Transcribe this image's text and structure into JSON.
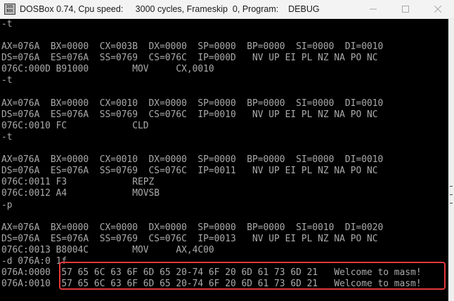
{
  "window": {
    "title": "DOSBox 0.74, Cpu speed:     3000 cycles, Frameskip  0, Program:    DEBUG",
    "icon_label": "DOS BOX"
  },
  "caption": {
    "minimize": "minimize-icon",
    "maximize": "maximize-icon",
    "close": "close-icon"
  },
  "terminal": {
    "lines": [
      "-t",
      "",
      "AX=076A  BX=0000  CX=003B  DX=0000  SP=0000  BP=0000  SI=0000  DI=0010",
      "DS=076A  ES=076A  SS=0769  CS=076C  IP=000D   NV UP EI PL NZ NA PO NC",
      "076C:000D B91000        MOV     CX,0010",
      "-t",
      "",
      "AX=076A  BX=0000  CX=0010  DX=0000  SP=0000  BP=0000  SI=0000  DI=0010",
      "DS=076A  ES=076A  SS=0769  CS=076C  IP=0010   NV UP EI PL NZ NA PO NC",
      "076C:0010 FC            CLD",
      "-t",
      "",
      "AX=076A  BX=0000  CX=0010  DX=0000  SP=0000  BP=0000  SI=0000  DI=0010",
      "DS=076A  ES=076A  SS=0769  CS=076C  IP=0011   NV UP EI PL NZ NA PO NC",
      "076C:0011 F3            REPZ",
      "076C:0012 A4            MOVSB",
      "-p",
      "",
      "AX=076A  BX=0000  CX=0000  DX=0000  SP=0000  BP=0000  SI=0010  DI=0020",
      "DS=076A  ES=076A  SS=0769  CS=076C  IP=0013   NV UP EI PL NZ NA PO NC",
      "076C:0013 B8004C        MOV     AX,4C00",
      "-d 076A:0 1f",
      "076A:0000  57 65 6C 63 6F 6D 65 20-74 6F 20 6D 61 73 6D 21   Welcome to masm!",
      "076A:0010  57 65 6C 63 6F 6D 65 20-74 6F 20 6D 61 73 6D 21   Welcome to masm!"
    ]
  },
  "colors": {
    "terminal_bg": "#000000",
    "terminal_fg": "#aaaaaa",
    "highlight": "#e5383b",
    "titlebar_bg": "#f3f3f3"
  }
}
